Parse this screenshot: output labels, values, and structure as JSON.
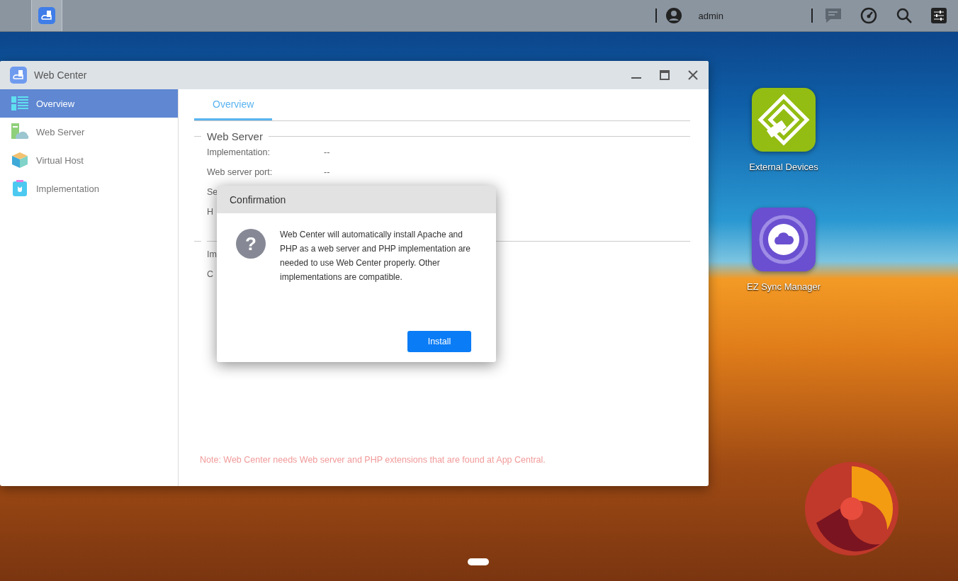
{
  "taskbar": {
    "user": "admin"
  },
  "window": {
    "title": "Web Center",
    "sidebar": [
      {
        "label": "Overview",
        "selected": true
      },
      {
        "label": "Web Server",
        "selected": false
      },
      {
        "label": "Virtual Host",
        "selected": false
      },
      {
        "label": "Implementation",
        "selected": false
      }
    ],
    "tabs": [
      {
        "label": "Overview",
        "selected": true
      }
    ],
    "sections": [
      {
        "title": "Web Server",
        "rows": [
          {
            "label": "Implementation:",
            "value": "--"
          },
          {
            "label": "Web server port:",
            "value": "--"
          },
          {
            "label": "Se"
          },
          {
            "label": "H"
          }
        ]
      },
      {
        "rows": [
          {
            "label": "Im"
          },
          {
            "label": "C"
          }
        ]
      }
    ],
    "note": "Note: Web Center needs Web server and PHP extensions that are found at App Central."
  },
  "dialog": {
    "title": "Confirmation",
    "icon_glyph": "?",
    "message": "Web Center will automatically install Apache and PHP as a web server and PHP implementation are needed to use Web Center properly. Other implementations are compatible.",
    "button": "Install"
  },
  "desktop_icons": [
    {
      "label": "External Devices",
      "kind": "usb"
    },
    {
      "label": "EZ Sync Manager",
      "kind": "sync"
    }
  ]
}
